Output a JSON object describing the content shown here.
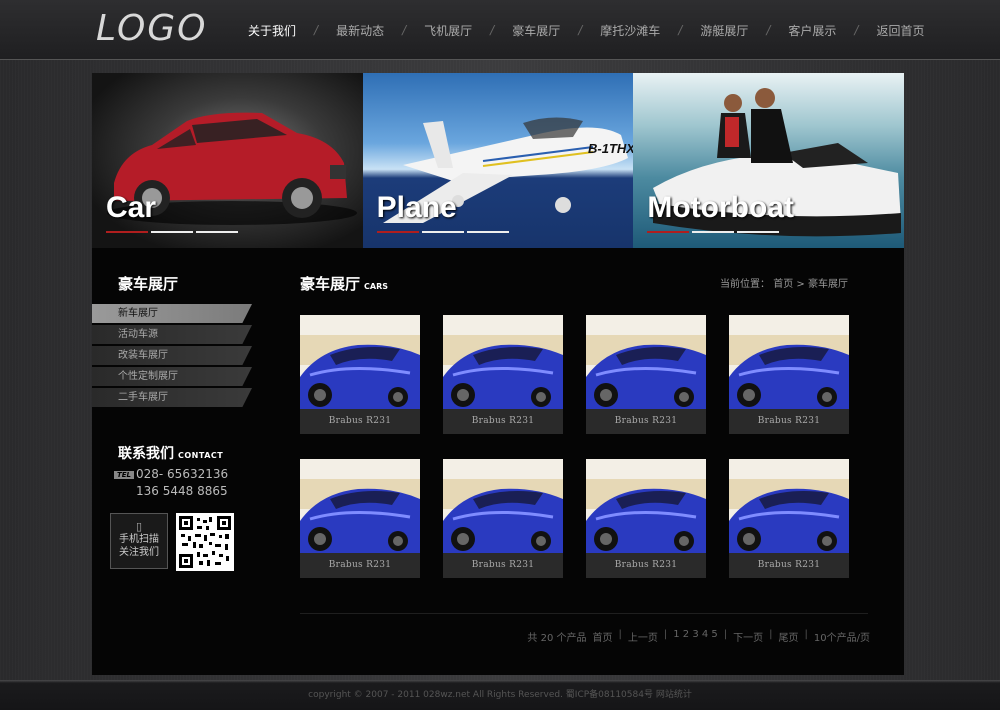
{
  "header": {
    "logo": "LOGO",
    "nav": [
      {
        "label": "关于我们",
        "active": true
      },
      {
        "label": "最新动态"
      },
      {
        "label": "飞机展厅"
      },
      {
        "label": "豪车展厅"
      },
      {
        "label": "摩托沙滩车"
      },
      {
        "label": "游艇展厅"
      },
      {
        "label": "客户展示"
      },
      {
        "label": "返回首页"
      }
    ]
  },
  "banner": [
    {
      "title": "Car"
    },
    {
      "title": "Plane"
    },
    {
      "title": "Motorboat"
    }
  ],
  "sidebar": {
    "title": "豪车展厅",
    "items": [
      {
        "label": "新车展厅",
        "active": true
      },
      {
        "label": "活动车源"
      },
      {
        "label": "改装车展厅"
      },
      {
        "label": "个性定制展厅"
      },
      {
        "label": "二手车展厅"
      }
    ],
    "contact": {
      "title": "联系我们",
      "title_en": "CONTACT",
      "tel_badge": "TEL",
      "phone1": "028- 65632136",
      "phone2": "136 5448 8865",
      "scan_line1": "手机扫描",
      "scan_line2": "关注我们"
    }
  },
  "content": {
    "title": "豪车展厅",
    "title_en": "CARS",
    "breadcrumb_label": "当前位置：",
    "breadcrumb_home": "首页",
    "breadcrumb_sep": ">",
    "breadcrumb_current": "豪车展厅",
    "products": [
      {
        "name": "Brabus R231"
      },
      {
        "name": "Brabus R231"
      },
      {
        "name": "Brabus R231"
      },
      {
        "name": "Brabus R231"
      },
      {
        "name": "Brabus R231"
      },
      {
        "name": "Brabus R231"
      },
      {
        "name": "Brabus R231"
      },
      {
        "name": "Brabus R231"
      }
    ],
    "pager": {
      "total": "共 20 个产品",
      "first": "首页",
      "prev": "上一页",
      "pages": "1 2 3 4 5",
      "next": "下一页",
      "last": "尾页",
      "per_page": "10个产品/页"
    }
  },
  "footer": {
    "copyright": "copyright © 2007 - 2011 028wz.net All Rights Reserved. 蜀ICP备08110584号 网站统计"
  },
  "colors": {
    "accent_red": "#b01e1e",
    "car_blue": "#2a3ac0"
  }
}
